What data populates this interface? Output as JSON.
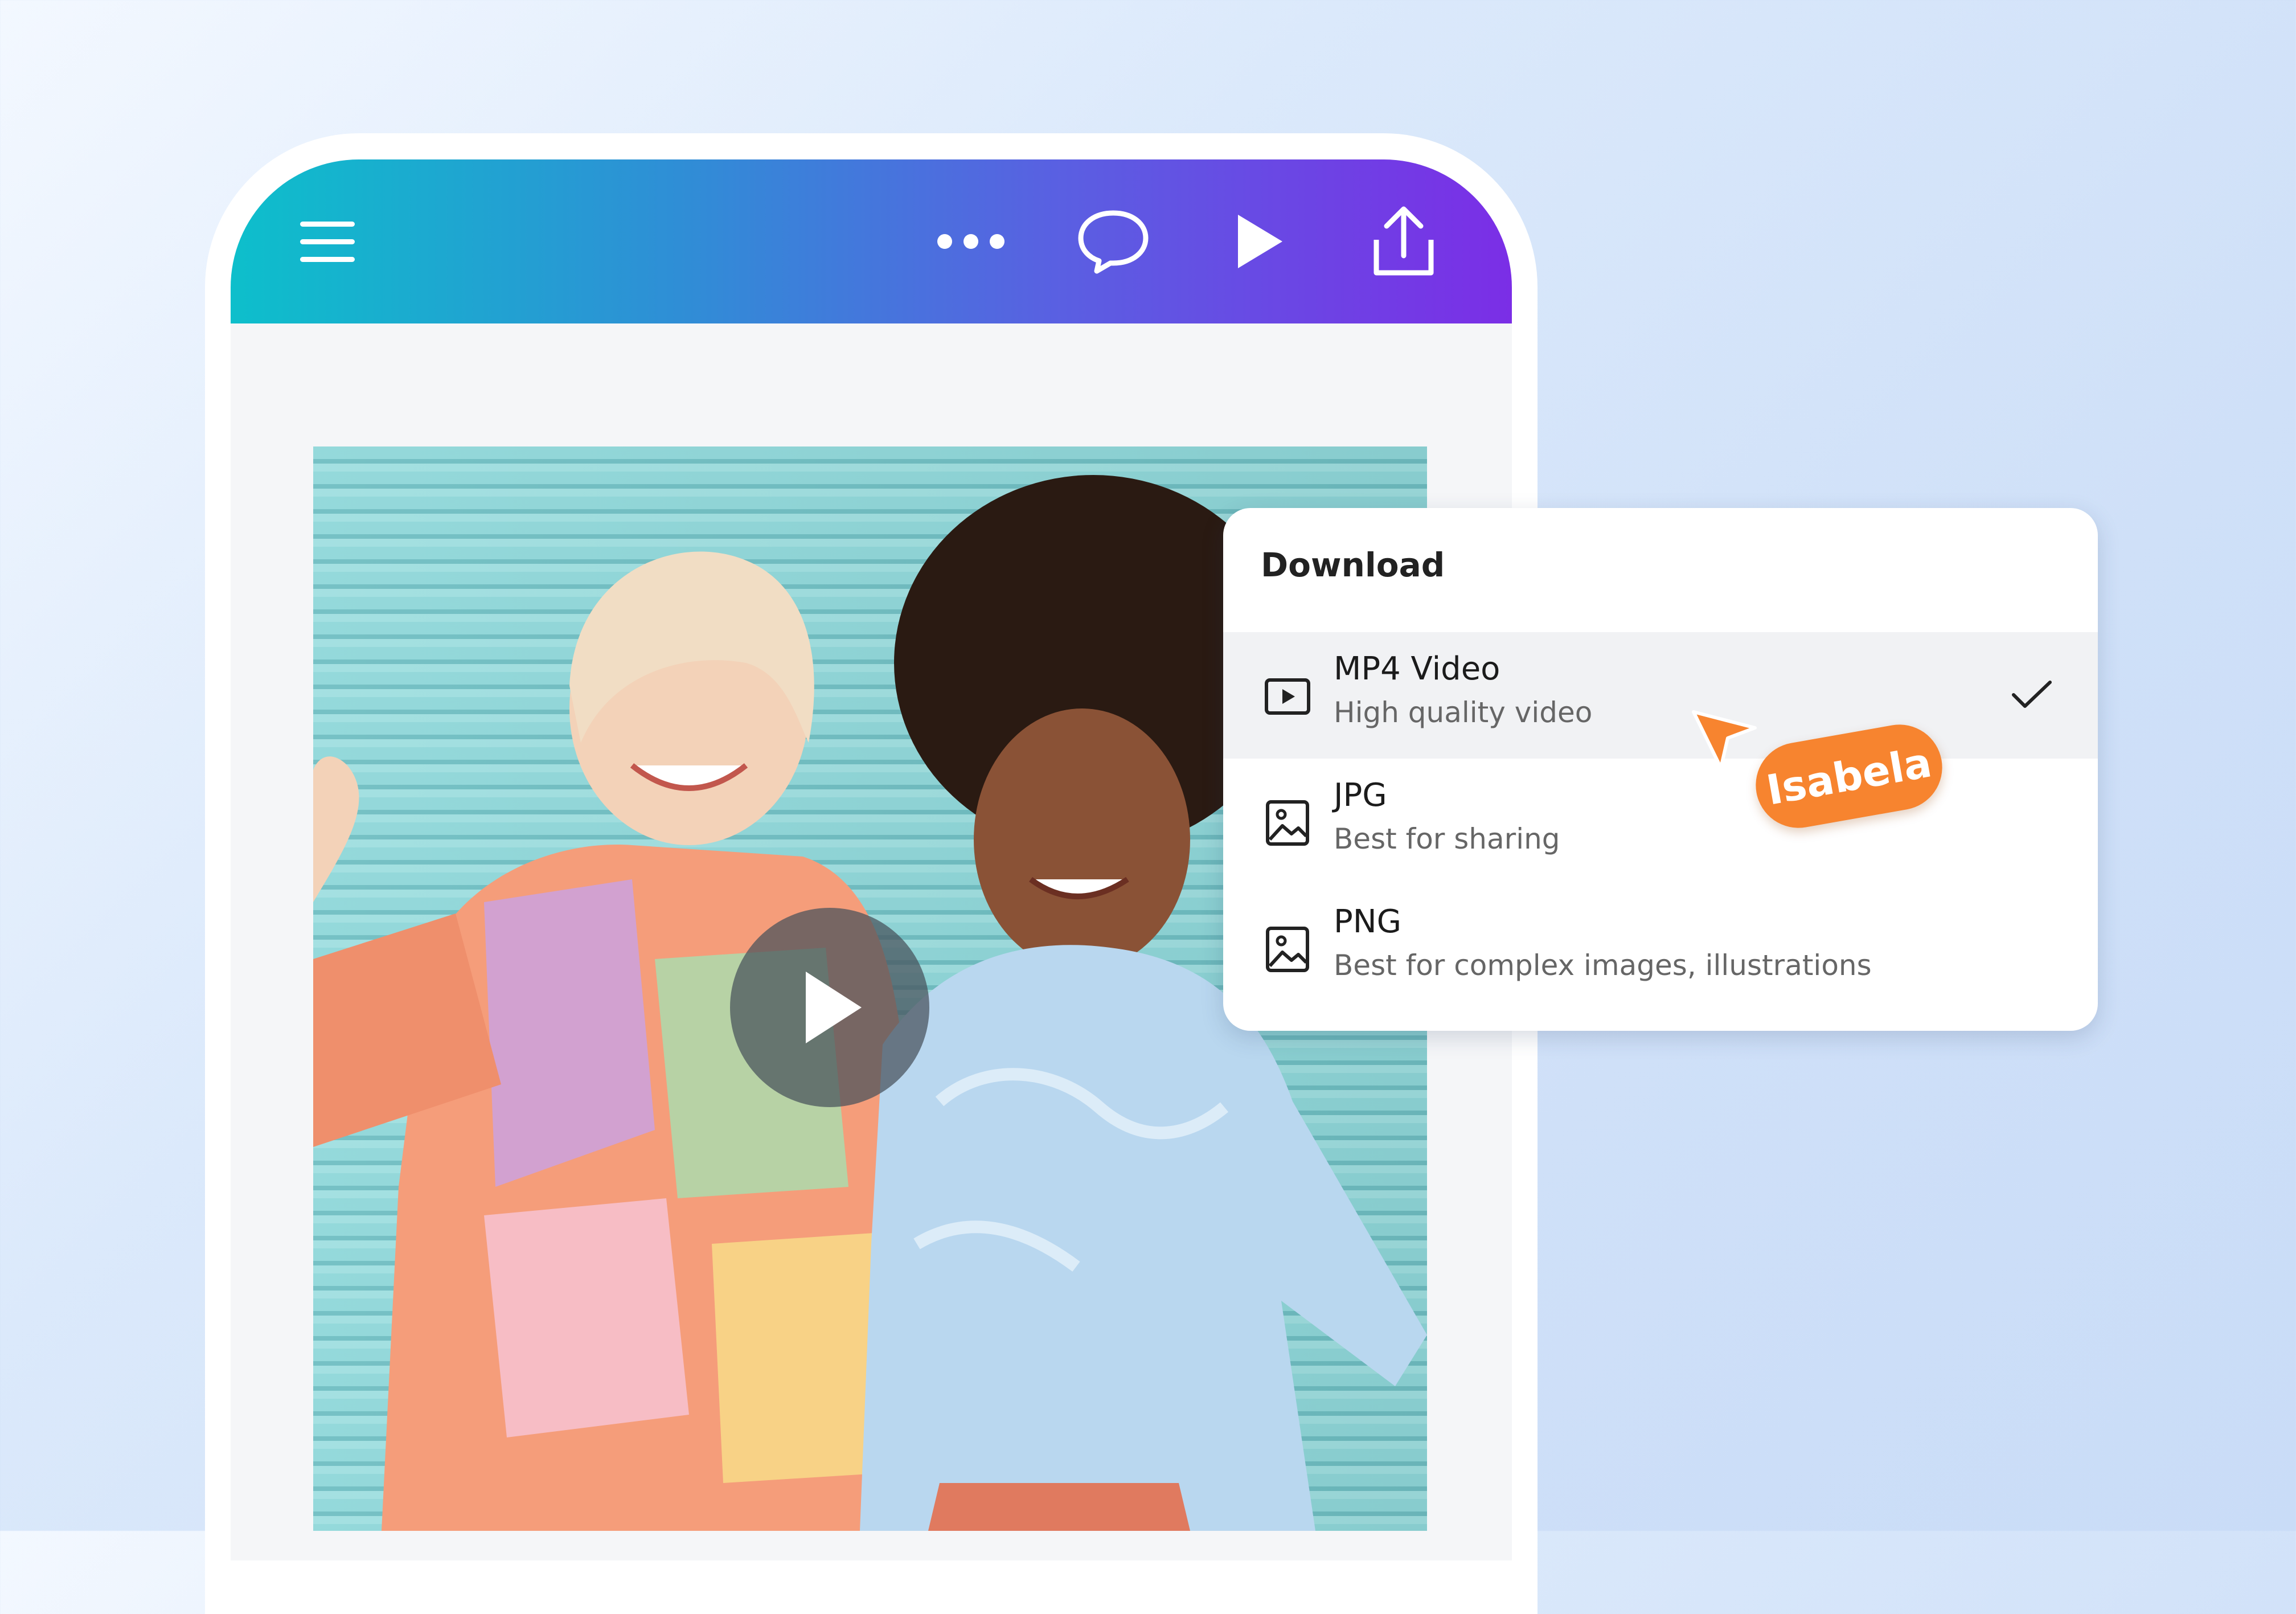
{
  "topbar": {
    "gradient_start": "#0dbfcb",
    "gradient_end": "#7b2ee6",
    "icons": [
      "menu-icon",
      "more-icon",
      "comment-icon",
      "play-icon",
      "share-icon"
    ]
  },
  "colors": {
    "accent_orange": "#f7842f",
    "panel_bg": "#ffffff",
    "selected_row": "#f1f2f4"
  },
  "download_panel": {
    "title": "Download",
    "options": [
      {
        "name": "MP4 Video",
        "description": "High quality video",
        "icon": "video-file-icon",
        "selected": true
      },
      {
        "name": "JPG",
        "description": "Best for sharing",
        "icon": "image-icon",
        "selected": false
      },
      {
        "name": "PNG",
        "description": "Best for complex images, illustrations",
        "icon": "image-icon",
        "selected": false
      }
    ]
  },
  "collaborator": {
    "name": "Isabela"
  }
}
